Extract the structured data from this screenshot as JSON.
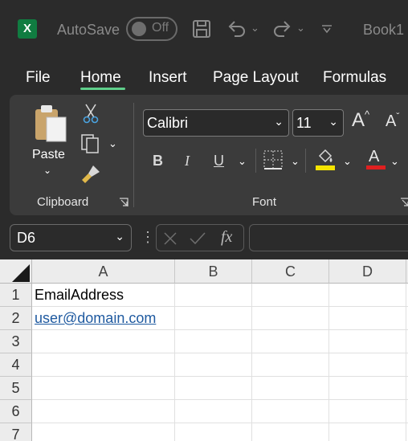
{
  "titlebar": {
    "app_icon": "X",
    "autosave_label": "AutoSave",
    "autosave_state": "Off",
    "save_icon": "save-icon",
    "undo_icon": "undo-icon",
    "redo_icon": "redo-icon",
    "customize_icon": "customize-qat-icon",
    "book_title": "Book1"
  },
  "tabs": [
    "File",
    "Home",
    "Insert",
    "Page Layout",
    "Formulas"
  ],
  "active_tab": "Home",
  "ribbon": {
    "clipboard": {
      "paste_label": "Paste",
      "group_label": "Clipboard"
    },
    "font": {
      "font_name": "Calibri",
      "font_size": "11",
      "bold": "B",
      "italic": "I",
      "underline": "U",
      "font_color_glyph": "A",
      "increase_font": "A",
      "decrease_font": "A",
      "group_label": "Font"
    }
  },
  "formula_bar": {
    "name_box": "D6",
    "fx_label": "fx",
    "formula": ""
  },
  "grid": {
    "columns": [
      "A",
      "B",
      "C",
      "D"
    ],
    "rows": [
      "1",
      "2",
      "3",
      "4",
      "5",
      "6",
      "7"
    ],
    "cells": {
      "A1": "EmailAddress",
      "A2": "user@domain.com"
    }
  },
  "colors": {
    "accent_green": "#5fcf8b",
    "excel_green": "#107c41",
    "highlight_yellow": "#f5e400",
    "font_red": "#e02020",
    "link_blue": "#1f5aa0"
  }
}
